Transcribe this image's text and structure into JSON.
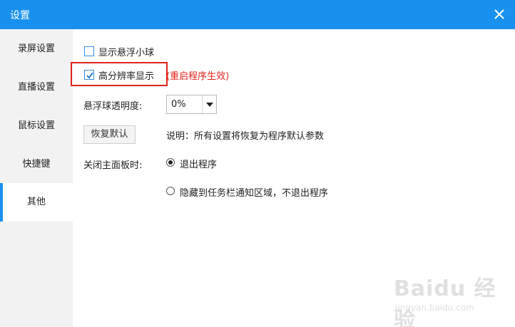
{
  "window": {
    "title": "设置"
  },
  "sidebar": {
    "items": [
      {
        "label": "录屏设置"
      },
      {
        "label": "直播设置"
      },
      {
        "label": "鼠标设置"
      },
      {
        "label": "快捷键"
      },
      {
        "label": "其他",
        "active": true
      }
    ]
  },
  "settings": {
    "floating_ball": {
      "label": "显示悬浮小球",
      "checked": false
    },
    "high_dpi": {
      "label": "高分辨率显示",
      "checked": true,
      "note": "(重启程序生效)"
    },
    "opacity": {
      "label": "悬浮球透明度:",
      "value": "0%"
    },
    "restore": {
      "button_label": "恢复默认",
      "description": "说明：所有设置将恢复为程序默认参数"
    },
    "close_panel": {
      "label": "关闭主面板时:",
      "options": [
        {
          "label": "退出程序",
          "selected": true
        },
        {
          "label": "隐藏到任务栏通知区域，不退出程序",
          "selected": false
        }
      ]
    }
  },
  "watermark": {
    "logo": "Baidu 经验",
    "url": "jingyan.baidu.com"
  },
  "colors": {
    "accent": "#1890f0",
    "highlight": "#e0231b",
    "sidebar_bg": "#f2f2f2"
  }
}
